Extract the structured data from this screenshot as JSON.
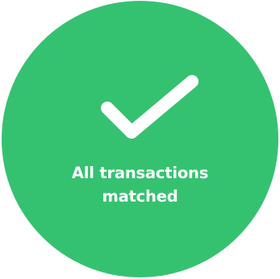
{
  "status": {
    "icon": "checkmark-icon",
    "line1": "All transactions",
    "line2": "matched"
  },
  "colors": {
    "badge": "#35c270",
    "foreground": "#ffffff"
  }
}
